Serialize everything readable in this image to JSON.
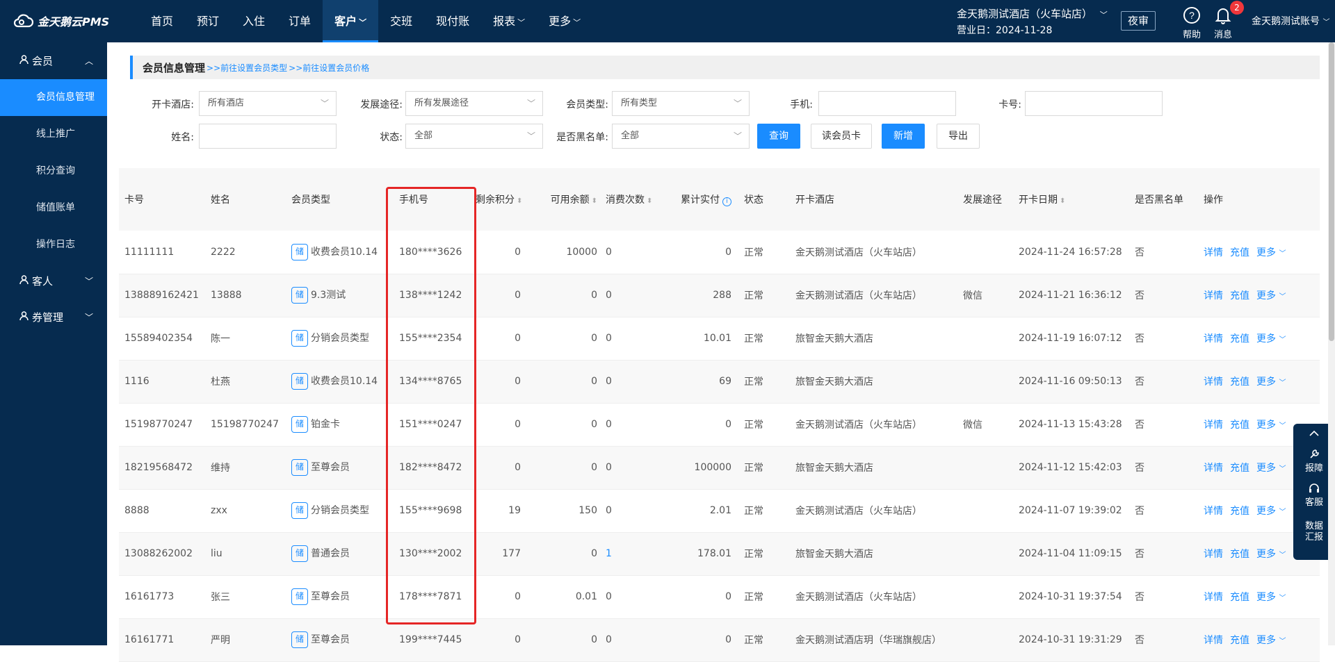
{
  "app": {
    "name": "金天鹅云PMS"
  },
  "nav": {
    "items": [
      {
        "label": "首页"
      },
      {
        "label": "预订"
      },
      {
        "label": "入住"
      },
      {
        "label": "订单"
      },
      {
        "label": "客户",
        "has_menu": true,
        "active": true
      },
      {
        "label": "交班"
      },
      {
        "label": "现付账"
      },
      {
        "label": "报表",
        "has_menu": true
      },
      {
        "label": "更多",
        "has_menu": true
      }
    ]
  },
  "header": {
    "hotel_name": "金天鹅测试酒店（火车站店）",
    "business_date": "营业日：2024-11-28",
    "night_audit": "夜审",
    "help": "帮助",
    "messages": "消息",
    "message_count": "2",
    "account": "金天鹅测试账号"
  },
  "sidebar": {
    "groups": [
      {
        "label": "会员",
        "expanded": true,
        "items": [
          {
            "label": "会员信息管理",
            "active": true
          },
          {
            "label": "线上推广"
          },
          {
            "label": "积分查询"
          },
          {
            "label": "储值账单"
          },
          {
            "label": "操作日志"
          }
        ]
      },
      {
        "label": "客人"
      },
      {
        "label": "券管理"
      }
    ]
  },
  "page": {
    "title": "会员信息管理",
    "link1": ">>前往设置会员类型",
    "link2": ">>前往设置会员价格"
  },
  "filters": {
    "hotel_label": "开卡酒店:",
    "hotel_value": "所有酒店",
    "channel_label": "发展途径:",
    "channel_value": "所有发展途径",
    "type_label": "会员类型:",
    "type_value": "所有类型",
    "phone_label": "手机:",
    "phone_value": "",
    "card_label": "卡号:",
    "card_value": "",
    "name_label": "姓名:",
    "name_value": "",
    "status_label": "状态:",
    "status_value": "全部",
    "blacklist_label": "是否黑名单:",
    "blacklist_value": "全部",
    "query_btn": "查询",
    "read_card_btn": "读会员卡",
    "add_btn": "新增",
    "export_btn": "导出"
  },
  "table": {
    "headers": {
      "card": "卡号",
      "name": "姓名",
      "type": "会员类型",
      "phone": "手机号",
      "points": "剩余积分",
      "balance": "可用余额",
      "count": "消费次数",
      "paid": "累计实付",
      "status": "状态",
      "hotel": "开卡酒店",
      "channel": "发展途径",
      "date": "开卡日期",
      "blacklist": "是否黑名单",
      "ops": "操作"
    },
    "tag": "储",
    "op_detail": "详情",
    "op_recharge": "充值",
    "op_more": "更多",
    "rows": [
      {
        "card": "11111111",
        "name": "2222",
        "type": "收费会员10.14",
        "phone": "180****3626",
        "points": "0",
        "balance": "10000",
        "count": "0",
        "paid": "0",
        "status": "正常",
        "hotel": "金天鹅测试酒店（火车站店）",
        "channel": "",
        "date": "2024-11-24 16:57:28",
        "blacklist": "否"
      },
      {
        "card": "138889162421",
        "name": "13888",
        "type": "9.3测试",
        "phone": "138****1242",
        "points": "0",
        "balance": "0",
        "count": "0",
        "paid": "288",
        "status": "正常",
        "hotel": "金天鹅测试酒店（火车站店）",
        "channel": "微信",
        "date": "2024-11-21 16:36:12",
        "blacklist": "否"
      },
      {
        "card": "15589402354",
        "name": "陈一",
        "type": "分销会员类型",
        "phone": "155****2354",
        "points": "0",
        "balance": "0",
        "count": "0",
        "paid": "10.01",
        "status": "正常",
        "hotel": "旅智金天鹅大酒店",
        "channel": "",
        "date": "2024-11-19 16:07:12",
        "blacklist": "否"
      },
      {
        "card": "1116",
        "name": "杜燕",
        "type": "收费会员10.14",
        "phone": "134****8765",
        "points": "0",
        "balance": "0",
        "count": "0",
        "paid": "69",
        "status": "正常",
        "hotel": "旅智金天鹅大酒店",
        "channel": "",
        "date": "2024-11-16 09:50:13",
        "blacklist": "否"
      },
      {
        "card": "15198770247",
        "name": "15198770247",
        "type": "铂金卡",
        "phone": "151****0247",
        "points": "0",
        "balance": "0",
        "count": "0",
        "paid": "0",
        "status": "正常",
        "hotel": "金天鹅测试酒店（火车站店）",
        "channel": "微信",
        "date": "2024-11-13 15:43:28",
        "blacklist": "否"
      },
      {
        "card": "18219568472",
        "name": "维持",
        "type": "至尊会员",
        "phone": "182****8472",
        "points": "0",
        "balance": "0",
        "count": "0",
        "paid": "100000",
        "status": "正常",
        "hotel": "旅智金天鹅大酒店",
        "channel": "",
        "date": "2024-11-12 15:42:03",
        "blacklist": "否"
      },
      {
        "card": "8888",
        "name": "zxx",
        "type": "分销会员类型",
        "phone": "155****9698",
        "points": "19",
        "balance": "150",
        "count": "0",
        "paid": "2.01",
        "status": "正常",
        "hotel": "金天鹅测试酒店（火车站店）",
        "channel": "",
        "date": "2024-11-07 19:39:02",
        "blacklist": "否"
      },
      {
        "card": "13088262002",
        "name": "liu",
        "type": "普通会员",
        "phone": "130****2002",
        "points": "177",
        "balance": "0",
        "count": "1",
        "paid": "178.01",
        "status": "正常",
        "hotel": "旅智金天鹅大酒店",
        "channel": "",
        "date": "2024-11-04 11:09:15",
        "blacklist": "否"
      },
      {
        "card": "16161773",
        "name": "张三",
        "type": "至尊会员",
        "phone": "178****7871",
        "points": "0",
        "balance": "0.01",
        "count": "0",
        "paid": "0",
        "status": "正常",
        "hotel": "金天鹅测试酒店（火车站店）",
        "channel": "",
        "date": "2024-10-31 19:37:54",
        "blacklist": "否"
      },
      {
        "card": "16161771",
        "name": "严明",
        "type": "至尊会员",
        "phone": "199****7445",
        "points": "0",
        "balance": "0",
        "count": "0",
        "paid": "0",
        "status": "正常",
        "hotel": "金天鹅测试酒店玥（华瑞旗舰店）",
        "channel": "",
        "date": "2024-10-31 19:31:29",
        "blacklist": "否"
      }
    ]
  },
  "float_panel": {
    "report": "报障",
    "service": "客服",
    "data": "数据",
    "data2": "汇报"
  },
  "colors": {
    "nav_bg": "#062b4f",
    "accent": "#1a8cff",
    "highlight": "#e52626"
  }
}
